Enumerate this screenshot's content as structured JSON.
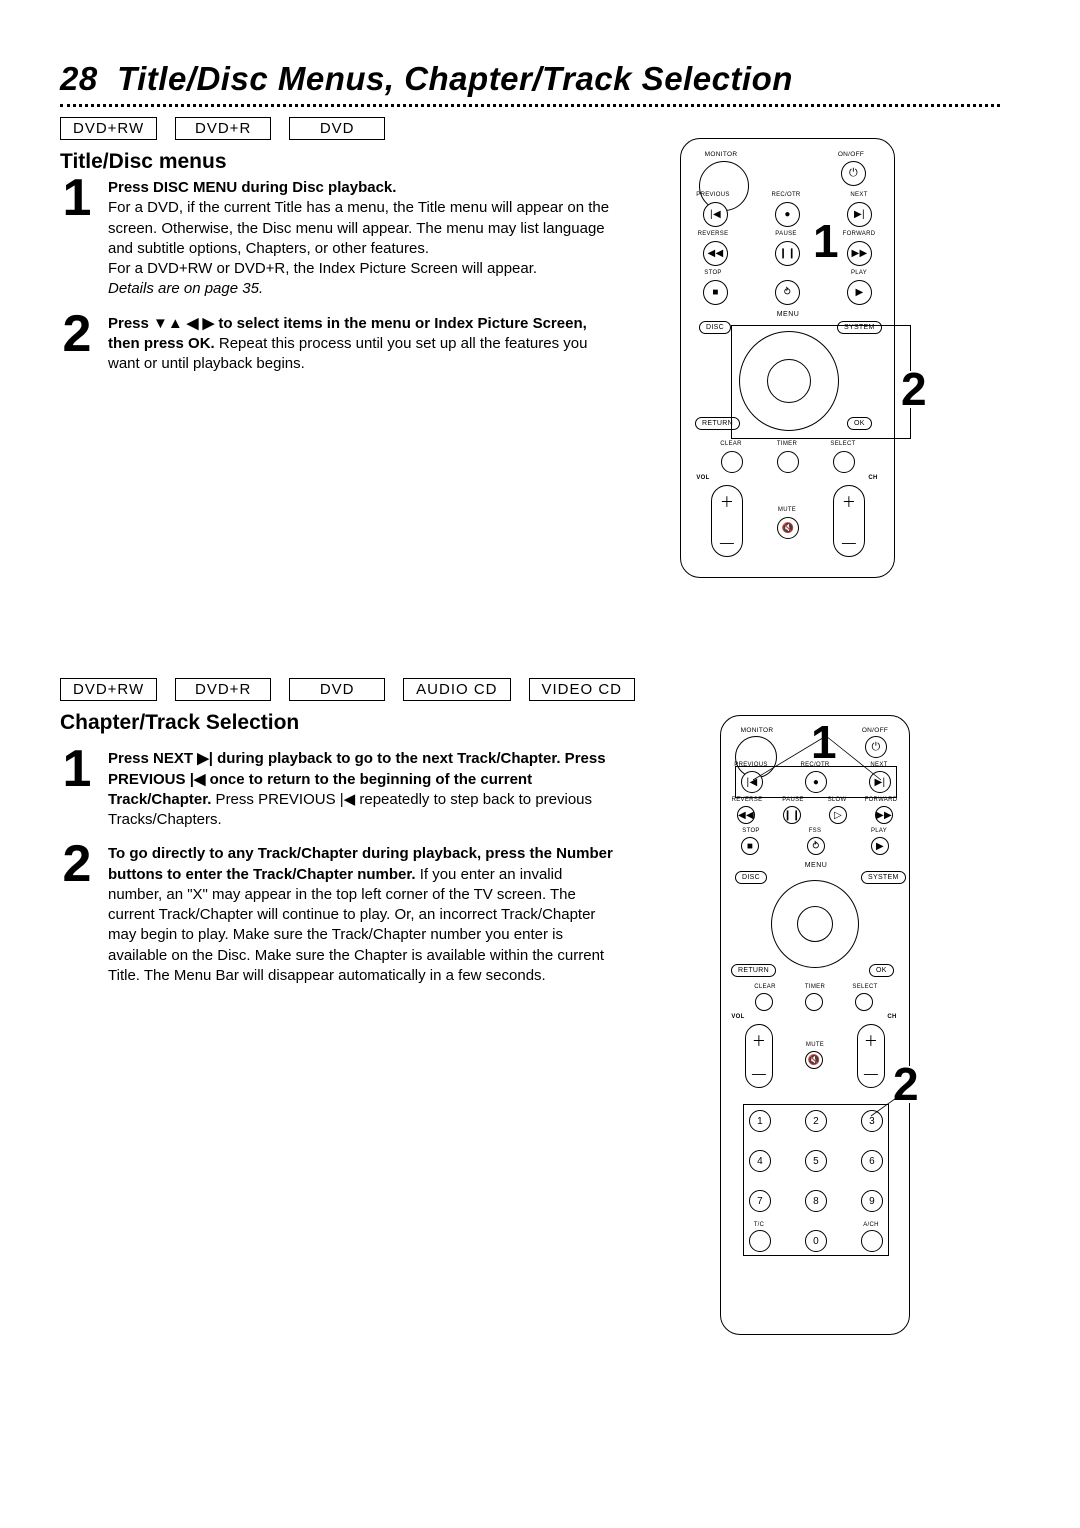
{
  "page_number": "28",
  "page_title": "Title/Disc Menus, Chapter/Track Selection",
  "section1": {
    "formats": [
      "DVD+RW",
      "DVD+R",
      "DVD"
    ],
    "heading": "Title/Disc menus",
    "step1": {
      "num": "1",
      "bold": "Press DISC MENU during Disc playback.",
      "body": "For a DVD, if the current Title has a menu, the Title menu will appear on the screen. Otherwise, the Disc menu will appear. The menu may list language and subtitle options, Chapters, or other features.",
      "body2": "For a DVD+RW or DVD+R, the Index Picture Screen will appear.",
      "italic": "Details are on page 35."
    },
    "step2": {
      "num": "2",
      "bold_a": "Press ",
      "arrows": "▼▲ ◀ ▶",
      "bold_b": " to select items in the menu or Index Picture Screen, then press OK.",
      "body": " Repeat this process until you set up all the features you want or until playback begins."
    }
  },
  "section2": {
    "formats": [
      "DVD+RW",
      "DVD+R",
      "DVD",
      "AUDIO CD",
      "VIDEO CD"
    ],
    "heading": "Chapter/Track Selection",
    "step1": {
      "num": "1",
      "bold_a": "Press NEXT ",
      "sym_next": "▶|",
      "bold_b": " during playback to go to the next Track/Chapter. Press PREVIOUS ",
      "sym_prev": "|◀",
      "bold_c": " once to return to the beginning of the current Track/Chapter.",
      "body_a": " Press PREVIOUS ",
      "sym_prev2": "|◀",
      "body_b": " repeatedly to step back to previous Tracks/Chapters."
    },
    "step2": {
      "num": "2",
      "bold": "To go directly to any Track/Chapter during playback, press the Number buttons to enter the Track/Chapter number.",
      "body": " If you enter an invalid number, an \"X\" may appear in the top left corner of the TV screen. The current Track/Chapter will continue to play. Or, an incorrect Track/Chapter may begin to play. Make sure the Track/Chapter number you enter is available on the Disc. Make sure the Chapter is available within the current Title. The Menu Bar will disappear automatically in a few seconds."
    }
  },
  "remote": {
    "monitor": "MONITOR",
    "onoff": "ON/OFF",
    "previous": "PREVIOUS",
    "recotr": "REC/OTR",
    "next": "NEXT",
    "reverse": "REVERSE",
    "pause": "PAUSE",
    "slow": "SLOW",
    "forward": "FORWARD",
    "stop": "STOP",
    "fss": "FSS",
    "play": "PLAY",
    "menu": "MENU",
    "disc": "DISC",
    "system": "SYSTEM",
    "return": "RETURN",
    "ok": "OK",
    "clear": "CLEAR",
    "timer": "TIMER",
    "select": "SELECT",
    "vol": "VOL",
    "ch": "CH",
    "mute": "MUTE",
    "tc": "T/C",
    "ach": "A/CH",
    "power": "⏻",
    "sym_prev": "|◀",
    "sym_next": "▶|",
    "sym_rec": "●",
    "sym_rew": "◀◀",
    "sym_pause": "❙❙",
    "sym_ff": "▶▶",
    "sym_stop": "■",
    "sym_play": "▶",
    "sym_fss": "⥁",
    "sym_slow": "▷",
    "sym_mute": "🔇",
    "sym_plus": "＋",
    "sym_minus": "—",
    "callout1": "1",
    "callout2": "2",
    "n": [
      "1",
      "2",
      "3",
      "4",
      "5",
      "6",
      "7",
      "8",
      "9",
      "0"
    ]
  }
}
